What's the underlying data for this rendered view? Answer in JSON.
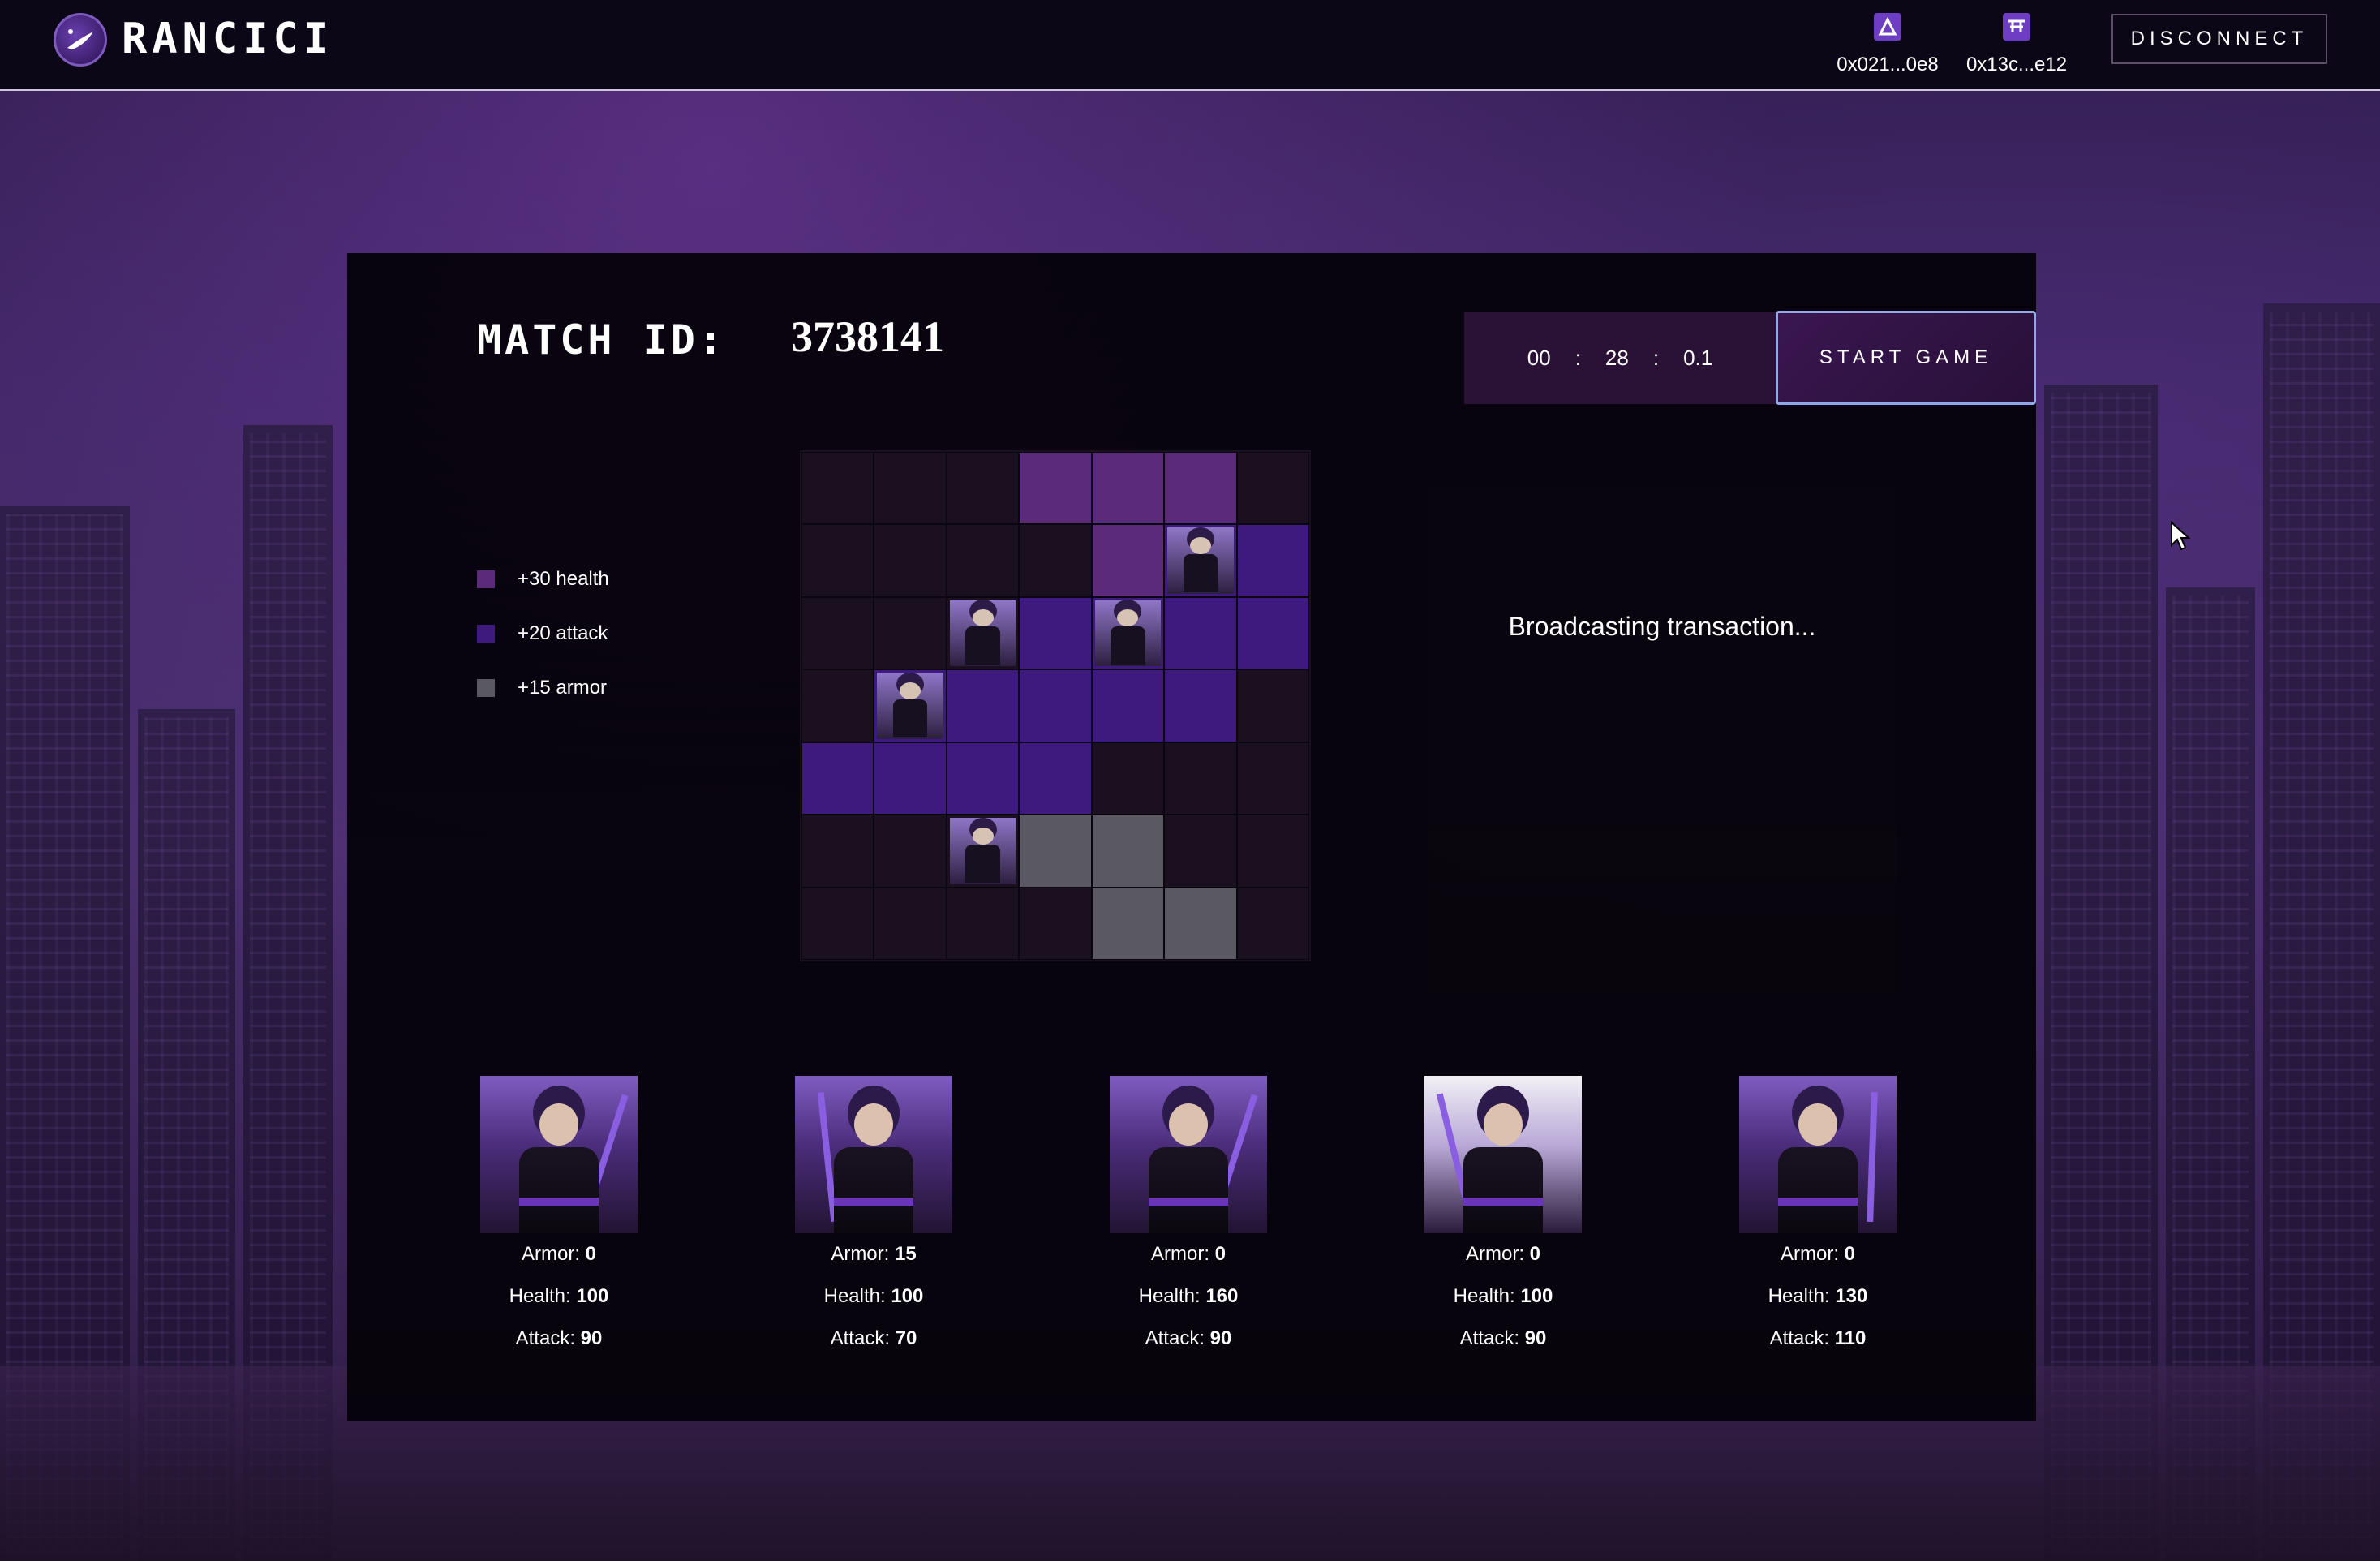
{
  "app": {
    "name": "RANCICI"
  },
  "header": {
    "wallets": [
      {
        "address": "0x021...0e8",
        "icon": "arbitrum-icon"
      },
      {
        "address": "0x13c...e12",
        "icon": "token-icon"
      }
    ],
    "disconnect_label": "DISCONNECT"
  },
  "match": {
    "label": "MATCH ID:",
    "id": "3738141",
    "timer": {
      "hours": "00",
      "minutes": "28",
      "seconds": "0.1",
      "sep": ":"
    },
    "start_label": "START GAME",
    "status": "Broadcasting transaction..."
  },
  "legend": [
    {
      "label": "+30 health",
      "color": "#5b2a7a"
    },
    {
      "label": "+20 attack",
      "color": "#3f1a7e"
    },
    {
      "label": "+15 armor",
      "color": "#5a5860"
    }
  ],
  "board": {
    "size": 7,
    "cells": [
      [
        "empty",
        "empty",
        "empty",
        "health",
        "health",
        "health",
        "empty"
      ],
      [
        "empty",
        "empty",
        "empty",
        "empty",
        "health",
        "attack",
        "attack"
      ],
      [
        "empty",
        "empty",
        "empty",
        "attack",
        "attack",
        "attack",
        "attack"
      ],
      [
        "empty",
        "attack",
        "attack",
        "attack",
        "attack",
        "attack",
        "empty"
      ],
      [
        "attack",
        "attack",
        "attack",
        "attack",
        "empty",
        "empty",
        "empty"
      ],
      [
        "empty",
        "empty",
        "empty",
        "armor",
        "armor",
        "empty",
        "empty"
      ],
      [
        "empty",
        "empty",
        "empty",
        "empty",
        "armor",
        "armor",
        "empty"
      ]
    ],
    "pieces": [
      {
        "row": 1,
        "col": 5,
        "character": 3
      },
      {
        "row": 2,
        "col": 2,
        "character": 4
      },
      {
        "row": 2,
        "col": 4,
        "character": 5
      },
      {
        "row": 3,
        "col": 1,
        "character": 1
      },
      {
        "row": 5,
        "col": 2,
        "character": 2
      }
    ]
  },
  "stat_labels": {
    "armor": "Armor:",
    "health": "Health:",
    "attack": "Attack:"
  },
  "characters": [
    {
      "armor": "0",
      "health": "100",
      "attack": "90",
      "style": "dark"
    },
    {
      "armor": "15",
      "health": "100",
      "attack": "70",
      "style": "dark"
    },
    {
      "armor": "0",
      "health": "160",
      "attack": "90",
      "style": "dark"
    },
    {
      "armor": "0",
      "health": "100",
      "attack": "90",
      "style": "light"
    },
    {
      "armor": "0",
      "health": "130",
      "attack": "110",
      "style": "dark"
    }
  ]
}
